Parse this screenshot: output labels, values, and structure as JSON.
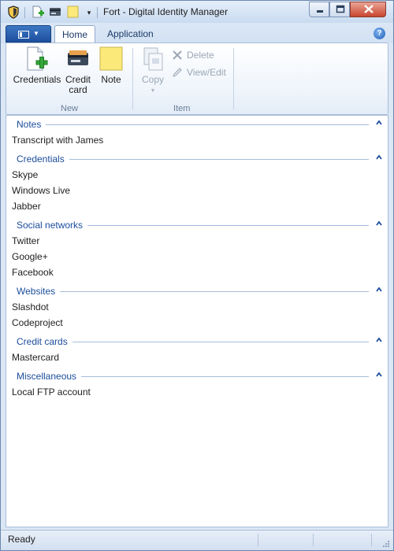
{
  "window": {
    "title": "Fort - Digital Identity Manager"
  },
  "ribbon": {
    "tabs": [
      {
        "label": "Home",
        "selected": true
      },
      {
        "label": "Application",
        "selected": false
      }
    ],
    "groups": {
      "new": {
        "label": "New",
        "credentials_label": "Credentials",
        "credit_card_label_line1": "Credit",
        "credit_card_label_line2": "card",
        "note_label": "Note"
      },
      "item": {
        "label": "Item",
        "copy_label": "Copy",
        "delete_label": "Delete",
        "view_edit_label": "View/Edit"
      }
    }
  },
  "list": {
    "groups": [
      {
        "title": "Notes",
        "items": [
          "Transcript with James"
        ]
      },
      {
        "title": "Credentials",
        "items": [
          "Skype",
          "Windows Live",
          "Jabber"
        ]
      },
      {
        "title": "Social networks",
        "items": [
          "Twitter",
          "Google+",
          "Facebook"
        ]
      },
      {
        "title": "Websites",
        "items": [
          "Slashdot",
          "Codeproject"
        ]
      },
      {
        "title": "Credit cards",
        "items": [
          "Mastercard"
        ]
      },
      {
        "title": "Miscellaneous",
        "items": [
          "Local FTP account"
        ]
      }
    ]
  },
  "statusbar": {
    "text": "Ready"
  },
  "colors": {
    "accent": "#1b4d9c",
    "app_menu": "#2a62b2",
    "note_yellow": "#fbe97a",
    "close_red": "#c9452f"
  },
  "icons": {
    "app": "shield-icon",
    "qat": [
      "new-credentials-icon",
      "new-credit-card-icon",
      "new-note-icon"
    ],
    "ribbon": [
      "credentials-icon",
      "credit-card-icon",
      "note-icon",
      "copy-icon",
      "delete-icon",
      "view-edit-icon"
    ]
  }
}
